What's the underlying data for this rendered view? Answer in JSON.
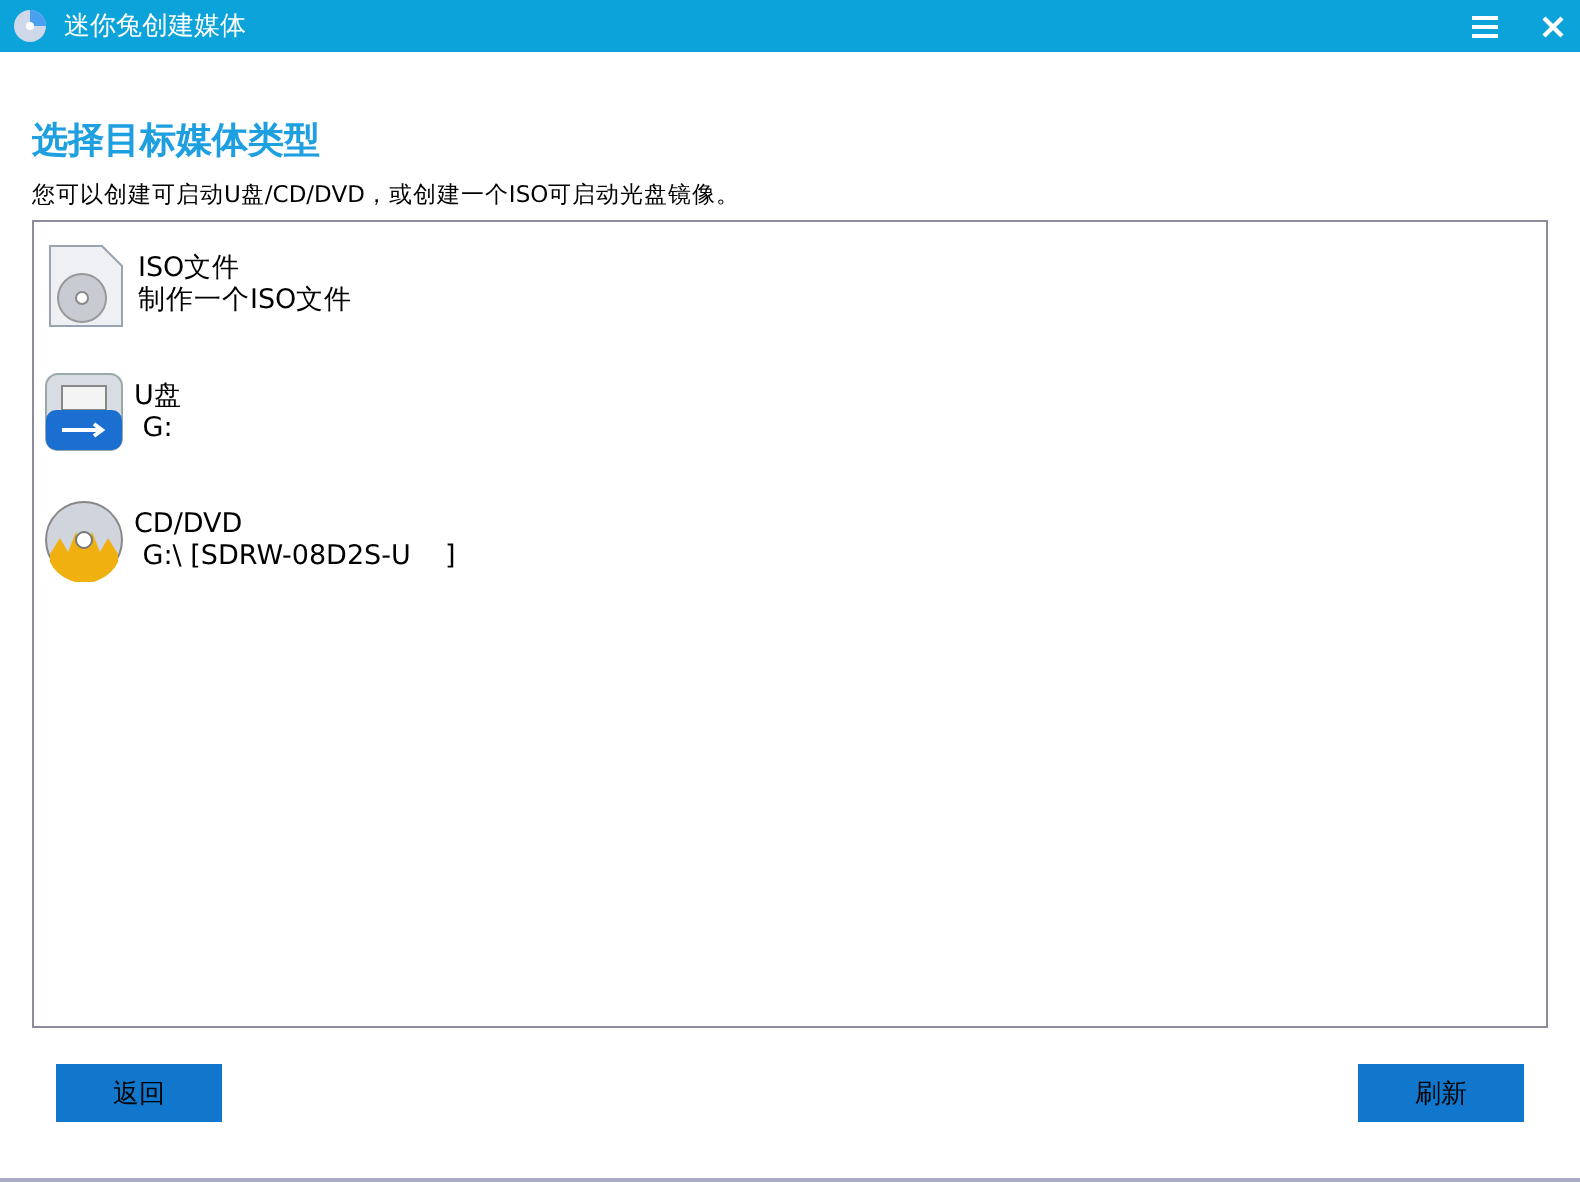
{
  "window": {
    "title": "迷你兔创建媒体"
  },
  "heading": "选择目标媒体类型",
  "subtitle": "您可以创建可启动U盘/CD/DVD，或创建一个ISO可启动光盘镜像。",
  "media": [
    {
      "kind": "iso",
      "name": "ISO文件",
      "detail": "制作一个ISO文件"
    },
    {
      "kind": "usb",
      "name": "U盘",
      "detail": " G:"
    },
    {
      "kind": "disc",
      "name": "CD/DVD",
      "detail": " G:\\ [SDRW-08D2S-U    ]"
    }
  ],
  "buttons": [
    "返回",
    "刷新"
  ]
}
